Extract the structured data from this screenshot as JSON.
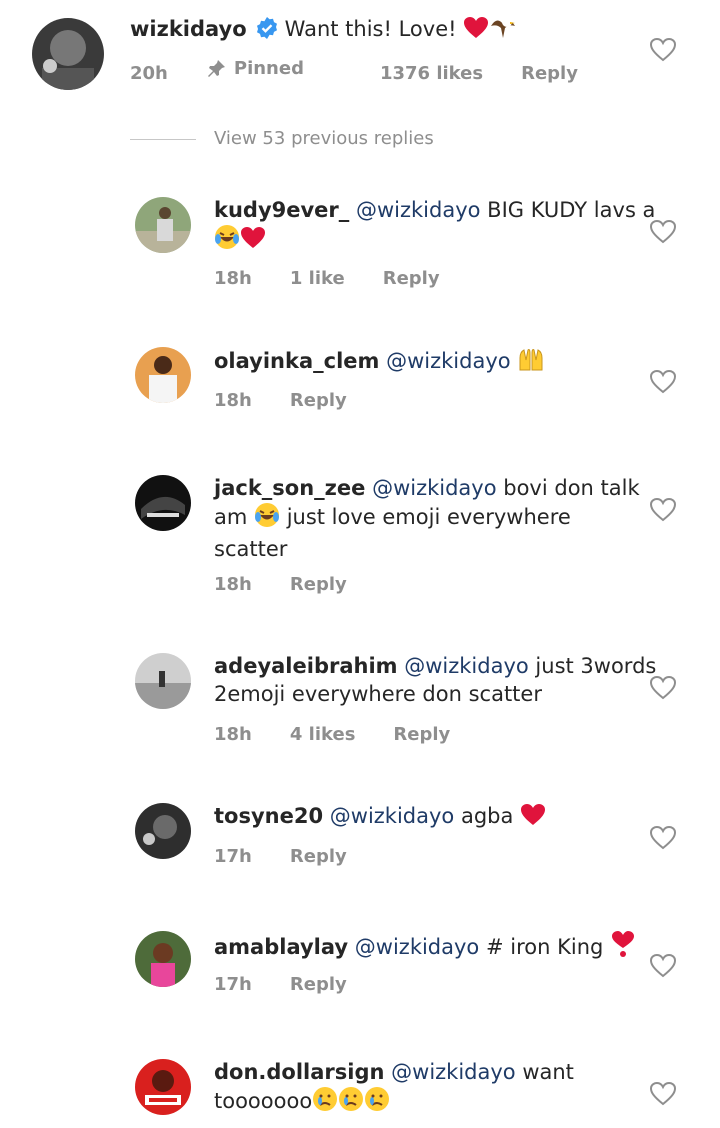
{
  "main_comment": {
    "username": "wizkidayo",
    "text": "Want this! Love!",
    "emojis": [
      "heart-emoji",
      "eagle-emoji"
    ],
    "time": "20h",
    "pinned_label": "Pinned",
    "likes": "1376 likes",
    "reply_label": "Reply"
  },
  "view_replies": "View 53 previous replies",
  "replies": [
    {
      "username": "kudy9ever_",
      "mention": "@wizkidayo",
      "text_a": " BIG KUDY lavs a",
      "text_b": "",
      "time": "18h",
      "likes": "1 like",
      "reply_label": "Reply"
    },
    {
      "username": "olayinka_clem",
      "mention": "@wizkidayo",
      "text": "",
      "time": "18h",
      "reply_label": "Reply"
    },
    {
      "username": "jack_son_zee",
      "mention": "@wizkidayo",
      "text_a": " bovi don talk",
      "text_b": "am",
      "text_c": " just love emoji everywhere",
      "text_d": "scatter",
      "time": "18h",
      "reply_label": "Reply"
    },
    {
      "username": "adeyaleibrahim",
      "mention": "@wizkidayo",
      "text_a": " just 3words",
      "text_b": "2emoji everywhere don scatter",
      "time": "18h",
      "likes": "4 likes",
      "reply_label": "Reply"
    },
    {
      "username": "tosyne20",
      "mention": "@wizkidayo",
      "text": " agba ",
      "time": "17h",
      "reply_label": "Reply"
    },
    {
      "username": "amablaylay",
      "mention": "@wizkidayo",
      "text": " # iron King ",
      "time": "17h",
      "reply_label": "Reply"
    },
    {
      "username": "don.dollarsign",
      "mention": "@wizkidayo",
      "text_a": " want",
      "text_b": "tooooooo",
      "time": "",
      "reply_label": ""
    }
  ],
  "colors": {
    "accent": "#1f3b67",
    "meta": "#8e8e8e",
    "verified": "#3897f0",
    "heart_red": "#e0143c"
  }
}
